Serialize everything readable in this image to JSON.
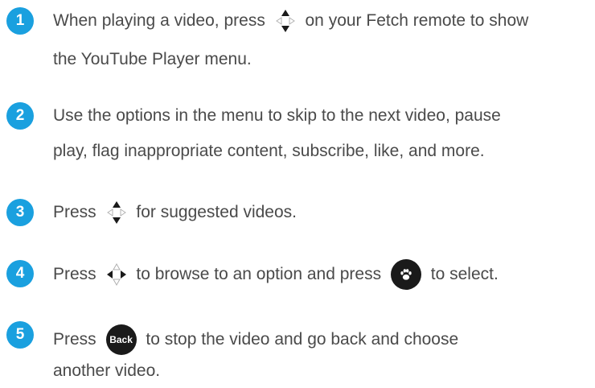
{
  "colors": {
    "badge": "#1aa0df",
    "text": "#4a4a4a",
    "button": "#1a1a1a"
  },
  "steps": [
    {
      "number": "1",
      "line1_before": "When playing a video, press",
      "line1_after": "on your Fetch remote to show",
      "line2": "the YouTube Player menu.",
      "icon": "dpad-up-down-icon"
    },
    {
      "number": "2",
      "line1": "Use the options in the menu to skip to the next video, pause",
      "line2": "play, flag inappropriate content, subscribe, like, and more."
    },
    {
      "number": "3",
      "line1_before": "Press",
      "line1_after": "for suggested videos.",
      "icon": "dpad-up-down-icon"
    },
    {
      "number": "4",
      "line1_before": "Press",
      "line1_middle": "to browse to an option and press",
      "line1_after": "to select.",
      "icon": "dpad-left-right-icon",
      "button_icon": "paw-icon"
    },
    {
      "number": "5",
      "line1_before": "Press",
      "line1_after": "to stop the video and go back and choose",
      "line2": "another video.",
      "button_label": "Back"
    }
  ]
}
